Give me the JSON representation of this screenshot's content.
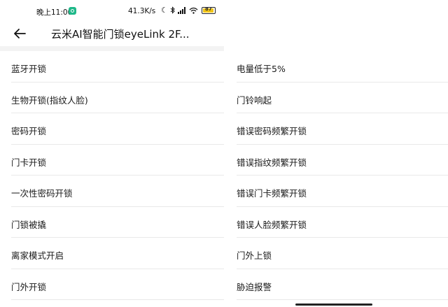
{
  "status_bar": {
    "time": "晚上11:00",
    "net_speed": "41.3K/s",
    "battery_level": "87",
    "icons": [
      "moon-icon",
      "bluetooth-icon",
      "signal-icon",
      "wifi-icon",
      "battery-icon"
    ]
  },
  "header": {
    "title": "云米AI智能门锁eyeLink 2F...",
    "back_icon": "back-arrow-icon"
  },
  "left_list": [
    {
      "label": "蓝牙开锁"
    },
    {
      "label": "生物开锁(指纹人脸)"
    },
    {
      "label": "密码开锁"
    },
    {
      "label": "门卡开锁"
    },
    {
      "label": "一次性密码开锁"
    },
    {
      "label": "门锁被撬"
    },
    {
      "label": "离家模式开启"
    },
    {
      "label": "门外开锁"
    }
  ],
  "right_list": [
    {
      "label": "电量低于5%"
    },
    {
      "label": "门铃响起"
    },
    {
      "label": "错误密码频繁开锁"
    },
    {
      "label": "错误指纹频繁开锁"
    },
    {
      "label": "错误门卡频繁开锁"
    },
    {
      "label": "错误人脸频繁开锁"
    },
    {
      "label": "门外上锁"
    },
    {
      "label": "胁迫报警"
    }
  ],
  "colors": {
    "background": "#ffffff",
    "separator": "#e9e9e9",
    "band": "#f3f3f3",
    "battery": "#f0c419",
    "app_icon": "#1fb889"
  }
}
